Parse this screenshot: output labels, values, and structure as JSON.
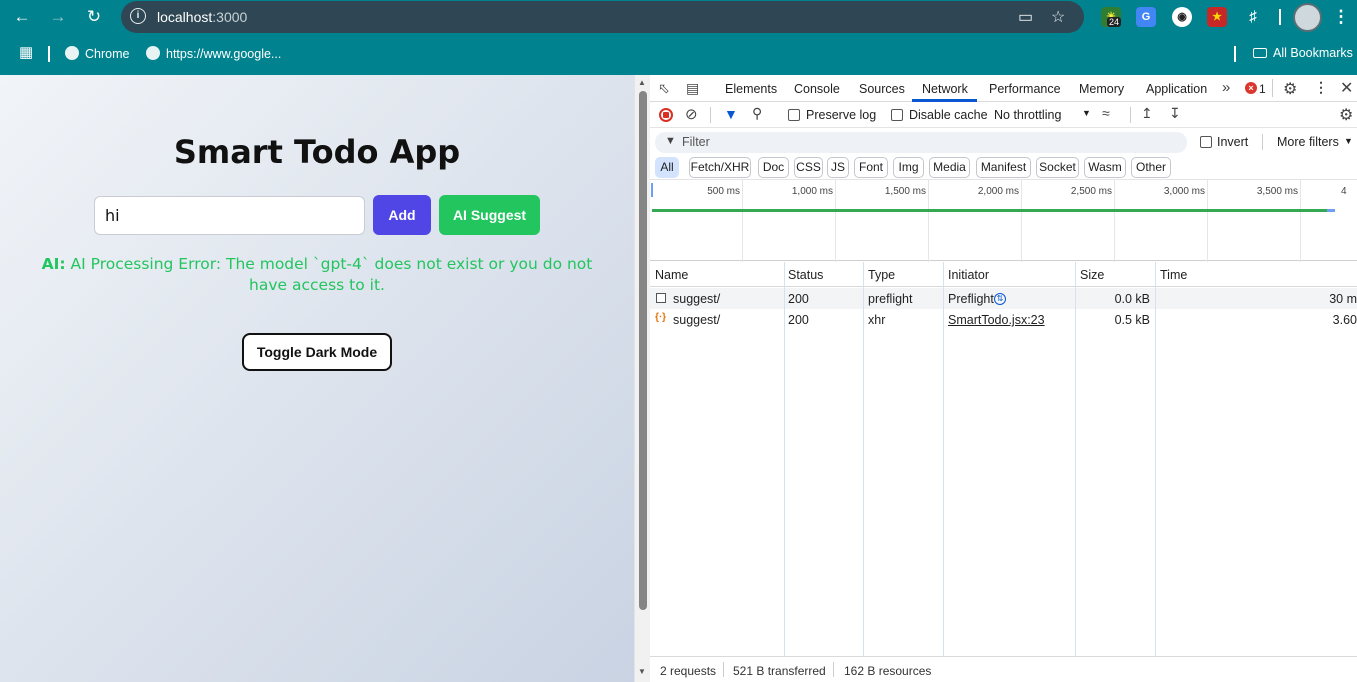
{
  "browser": {
    "url_host": "localhost",
    "url_port": ":3000",
    "back_icon": "arrow-left",
    "forward_icon": "arrow-right",
    "reload_icon": "reload",
    "extension_badge": "24",
    "bookmarks": [
      {
        "label": "Chrome"
      },
      {
        "label": "https://www.google..."
      }
    ],
    "all_bookmarks": "All Bookmarks",
    "theme_color": "#00838f"
  },
  "app": {
    "title": "Smart Todo App",
    "input_value": "hi",
    "add_label": "Add",
    "ai_suggest_label": "AI Suggest",
    "ai_prefix": "AI:",
    "ai_message": "AI Processing Error: The model `gpt-4` does not exist or you do not have access to it.",
    "toggle_label": "Toggle Dark Mode",
    "colors": {
      "add": "#4f46e5",
      "ai": "#22c55e"
    }
  },
  "devtools": {
    "tabs": [
      "Elements",
      "Console",
      "Sources",
      "Network",
      "Performance",
      "Memory",
      "Application"
    ],
    "active_tab": "Network",
    "error_count": "1",
    "preserve_log": "Preserve log",
    "disable_cache": "Disable cache",
    "throttling": "No throttling",
    "filter_placeholder": "Filter",
    "invert": "Invert",
    "more_filters": "More filters",
    "chips": [
      "All",
      "Fetch/XHR",
      "Doc",
      "CSS",
      "JS",
      "Font",
      "Img",
      "Media",
      "Manifest",
      "Socket",
      "Wasm",
      "Other"
    ],
    "timeline_labels": [
      "500 ms",
      "1,000 ms",
      "1,500 ms",
      "2,000 ms",
      "2,500 ms",
      "3,000 ms",
      "3,500 ms",
      "4"
    ],
    "columns": [
      "Name",
      "Status",
      "Type",
      "Initiator",
      "Size",
      "Time"
    ],
    "rows": [
      {
        "name": "suggest/",
        "status": "200",
        "type": "preflight",
        "initiator": "Preflight",
        "size": "0.0 kB",
        "time": "30 m"
      },
      {
        "name": "suggest/",
        "status": "200",
        "type": "xhr",
        "initiator": "SmartTodo.jsx:23",
        "size": "0.5 kB",
        "time": "3.60"
      }
    ],
    "summary": {
      "requests": "2 requests",
      "transferred": "521 B transferred",
      "resources": "162 B resources"
    }
  }
}
